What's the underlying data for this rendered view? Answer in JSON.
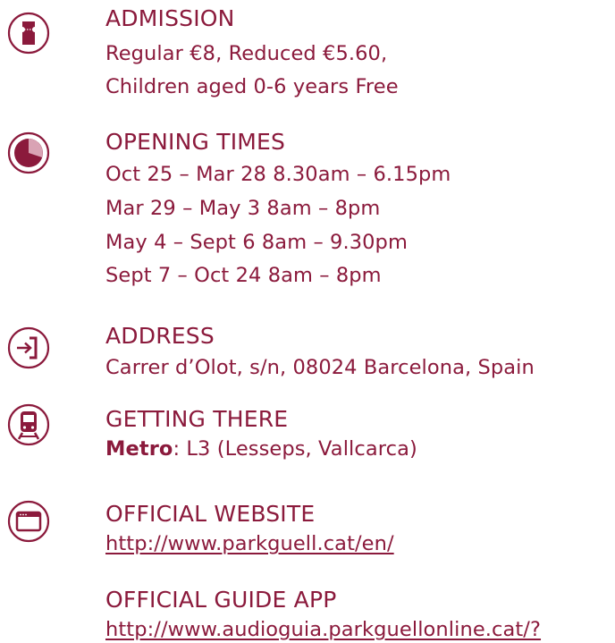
{
  "accent_color": "#8b1a3c",
  "sections": {
    "admission": {
      "icon": "ticket-icon",
      "heading": "ADMISSION",
      "lines": [
        "Regular €8, Reduced €5.60,",
        "Children aged 0-6 years Free"
      ]
    },
    "opening_times": {
      "icon": "clock-pie-icon",
      "heading": "OPENING TIMES",
      "lines": [
        "Oct 25 – Mar 28 8.30am – 6.15pm",
        "Mar 29 – May 3 8am – 8pm",
        "May 4 – Sept 6 8am – 9.30pm",
        "Sept 7 – Oct 24 8am – 8pm"
      ]
    },
    "address": {
      "icon": "sign-in-icon",
      "heading": "ADDRESS",
      "lines": [
        "Carrer d’Olot, s/n, 08024 Barcelona, Spain"
      ]
    },
    "getting_there": {
      "icon": "train-icon",
      "heading": "GETTING THERE",
      "label": "Metro",
      "detail": ": L3 (Lesseps, Vallcarca)"
    },
    "website": {
      "icon": "browser-window-icon",
      "heading": "OFFICIAL WEBSITE",
      "link": "http://www.parkguell.cat/en/"
    },
    "guide_app": {
      "heading": "OFFICIAL GUIDE APP",
      "link": "http://www.audioguia.parkguellonline.cat/?"
    }
  }
}
